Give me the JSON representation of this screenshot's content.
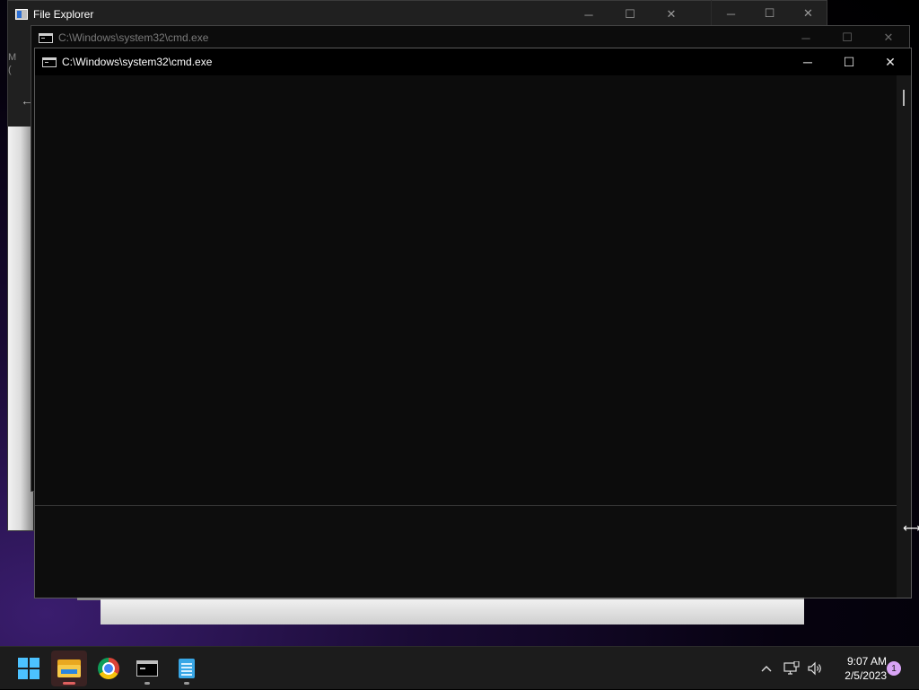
{
  "explorer": {
    "title": "File Explorer",
    "minimize_glyph": "─",
    "maximize_glyph": "☐",
    "close_glyph": "✕",
    "left_glyphs": [
      "M",
      "("
    ],
    "back_glyph": "←"
  },
  "cmd_back": {
    "title": "C:\\Windows\\system32\\cmd.exe",
    "minimize_glyph": "─",
    "maximize_glyph": "☐",
    "close_glyph": "✕"
  },
  "cmd_front": {
    "title": "C:\\Windows\\system32\\cmd.exe",
    "minimize_glyph": "─",
    "maximize_glyph": "☐",
    "close_glyph": "✕",
    "console_text": ""
  },
  "taskbar": {
    "items": [
      {
        "name": "start",
        "icon": "windows-logo-icon"
      },
      {
        "name": "file-explorer",
        "icon": "folder-icon",
        "running": true,
        "active": true
      },
      {
        "name": "chrome",
        "icon": "chrome-icon",
        "running": false
      },
      {
        "name": "command-prompt",
        "icon": "terminal-icon",
        "running": true
      },
      {
        "name": "notepad",
        "icon": "notepad-icon",
        "running": true
      }
    ],
    "tray": {
      "chevron_glyph": "^",
      "network_icon": "network-icon",
      "volume_icon": "volume-icon",
      "time": "9:07 AM",
      "date": "2/5/2023",
      "notification_count": "1"
    }
  },
  "colors": {
    "accent_blue": "#4cc2ff",
    "console_bg": "#0c0c0c",
    "taskbar_bg": "#1c1c1c",
    "notification_badge": "#d8a3f5"
  }
}
